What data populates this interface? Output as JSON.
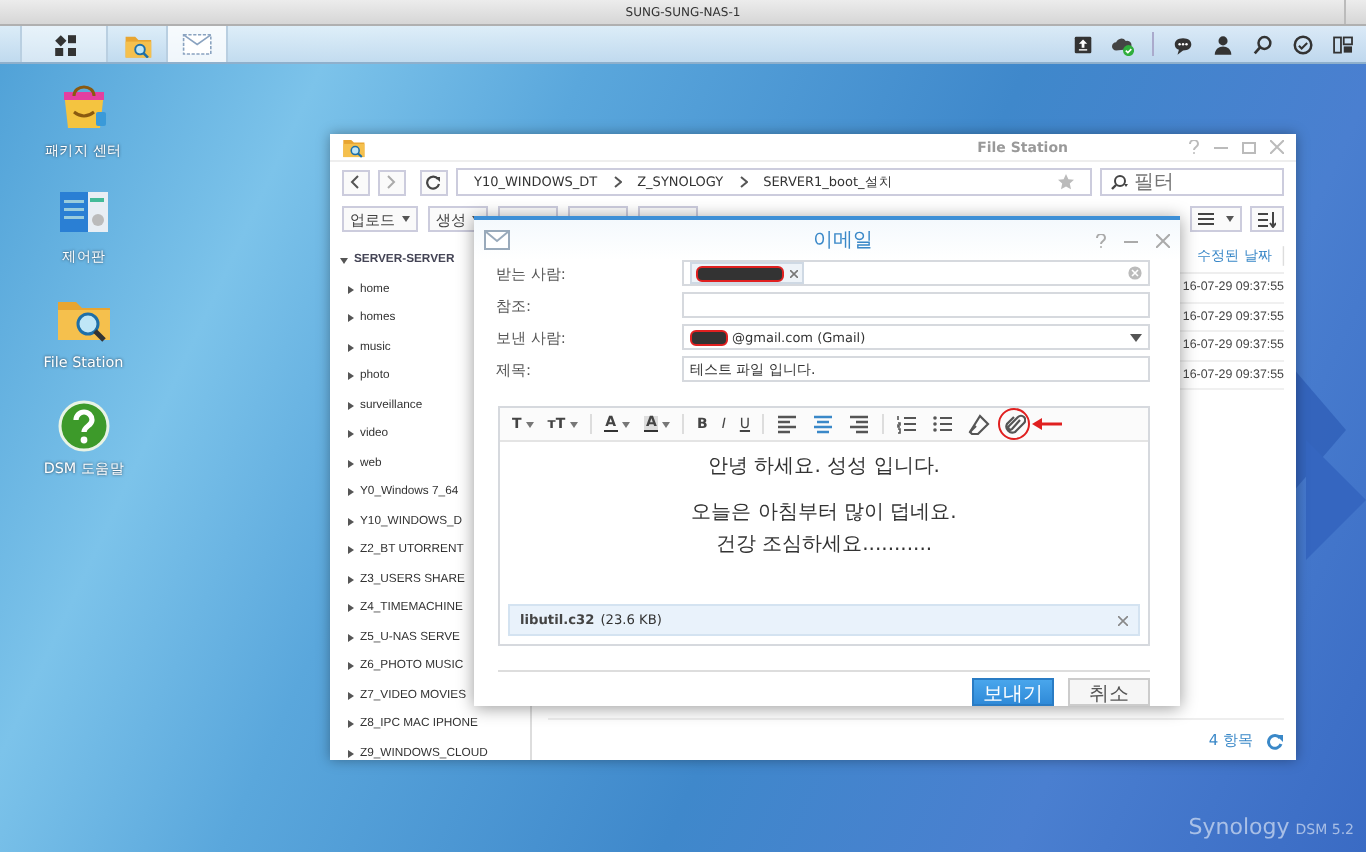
{
  "browser_title": "SUNG-SUNG-NAS-1",
  "taskbar": {
    "apps": [
      {
        "kind": "menu",
        "selected": false
      },
      {
        "kind": "filestation",
        "selected": false
      },
      {
        "kind": "mail",
        "selected": true
      }
    ],
    "tray": [
      {
        "kind": "upload"
      },
      {
        "kind": "cloud"
      },
      {
        "kind": "chat"
      },
      {
        "kind": "user"
      },
      {
        "kind": "search"
      },
      {
        "kind": "gauge"
      },
      {
        "kind": "widgets"
      }
    ]
  },
  "desktop_icons": [
    {
      "kind": "package",
      "label": "패키지 센터"
    },
    {
      "kind": "control",
      "label": "제어판"
    },
    {
      "kind": "filestation",
      "label": "File Station"
    },
    {
      "kind": "help",
      "label": "DSM 도움말"
    }
  ],
  "file_station": {
    "title": "File Station",
    "path": [
      "Y10_WINDOWS_DT",
      "Z_SYNOLOGY",
      "SERVER1_boot_설치"
    ],
    "search_placeholder": "필터",
    "toolbar_buttons": [
      "업로드",
      "생성"
    ],
    "tree": {
      "label": "SERVER-SERVER",
      "expanded": true,
      "children": [
        {
          "label": "home"
        },
        {
          "label": "homes"
        },
        {
          "label": "music"
        },
        {
          "label": "photo"
        },
        {
          "label": "surveillance"
        },
        {
          "label": "video"
        },
        {
          "label": "web"
        },
        {
          "label": "Y0_Windows 7_64"
        },
        {
          "label": "Y10_WINDOWS_D"
        },
        {
          "label": "Z2_BT UTORRENT"
        },
        {
          "label": "Z3_USERS SHARE"
        },
        {
          "label": "Z4_TIMEMACHINE"
        },
        {
          "label": "Z5_U-NAS SERVE"
        },
        {
          "label": "Z6_PHOTO MUSIC"
        },
        {
          "label": "Z7_VIDEO MOVIES"
        },
        {
          "label": "Z8_IPC MAC IPHONE"
        },
        {
          "label": "Z9_WINDOWS_CLOUD"
        }
      ]
    },
    "columns": [
      "수정된 날짜"
    ],
    "rows": [
      [
        "16-07-29 09:37:55"
      ],
      [
        "16-07-29 09:37:55"
      ],
      [
        "16-07-29 09:37:55"
      ],
      [
        "16-07-29 09:37:55"
      ]
    ],
    "item_count": "4 항목"
  },
  "email": {
    "title": "이메일",
    "fields": [
      {
        "kind": "chips",
        "label": "받는 사람:",
        "redacted": true
      },
      {
        "kind": "text",
        "label": "참조:"
      },
      {
        "kind": "select",
        "label": "보낸 사람:",
        "value": "@gmail.com (Gmail)",
        "redacted": true
      },
      {
        "kind": "text",
        "label": "제목:",
        "value": "테스트 파일 입니다."
      }
    ],
    "toolbar": [
      {
        "kind": "menu",
        "label": "T"
      },
      {
        "kind": "menu",
        "label": "тT"
      },
      {
        "kind": "separator"
      },
      {
        "kind": "textcolor",
        "label": "A"
      },
      {
        "kind": "highlight",
        "label": "A"
      },
      {
        "kind": "separator"
      },
      {
        "kind": "bold",
        "label": "B"
      },
      {
        "kind": "italic",
        "label": "I"
      },
      {
        "kind": "underline",
        "label": "U"
      },
      {
        "kind": "separator"
      },
      {
        "kind": "align-left",
        "selected": false
      },
      {
        "kind": "align-center",
        "selected": true
      },
      {
        "kind": "align-right",
        "selected": false
      },
      {
        "kind": "separator"
      },
      {
        "kind": "ordered-list",
        "selected": false
      },
      {
        "kind": "bullet-list",
        "selected": false
      },
      {
        "kind": "eraser",
        "selected": false
      },
      {
        "kind": "attach",
        "selected": false,
        "highlighted": true
      }
    ],
    "body": [
      [
        "안녕 하세요.  성성 입니다."
      ],
      [
        "오늘은 아침부터 많이 덥네요.",
        "건강 조심하세요..........."
      ]
    ],
    "attachment": {
      "name": "libutil.c32",
      "size": "(23.6 KB)"
    },
    "buttons": [
      {
        "kind": "primary",
        "label": "보내기"
      },
      {
        "kind": "secondary",
        "label": "취소"
      }
    ]
  },
  "branding": {
    "name": "Synology",
    "version": "DSM 5.2"
  }
}
